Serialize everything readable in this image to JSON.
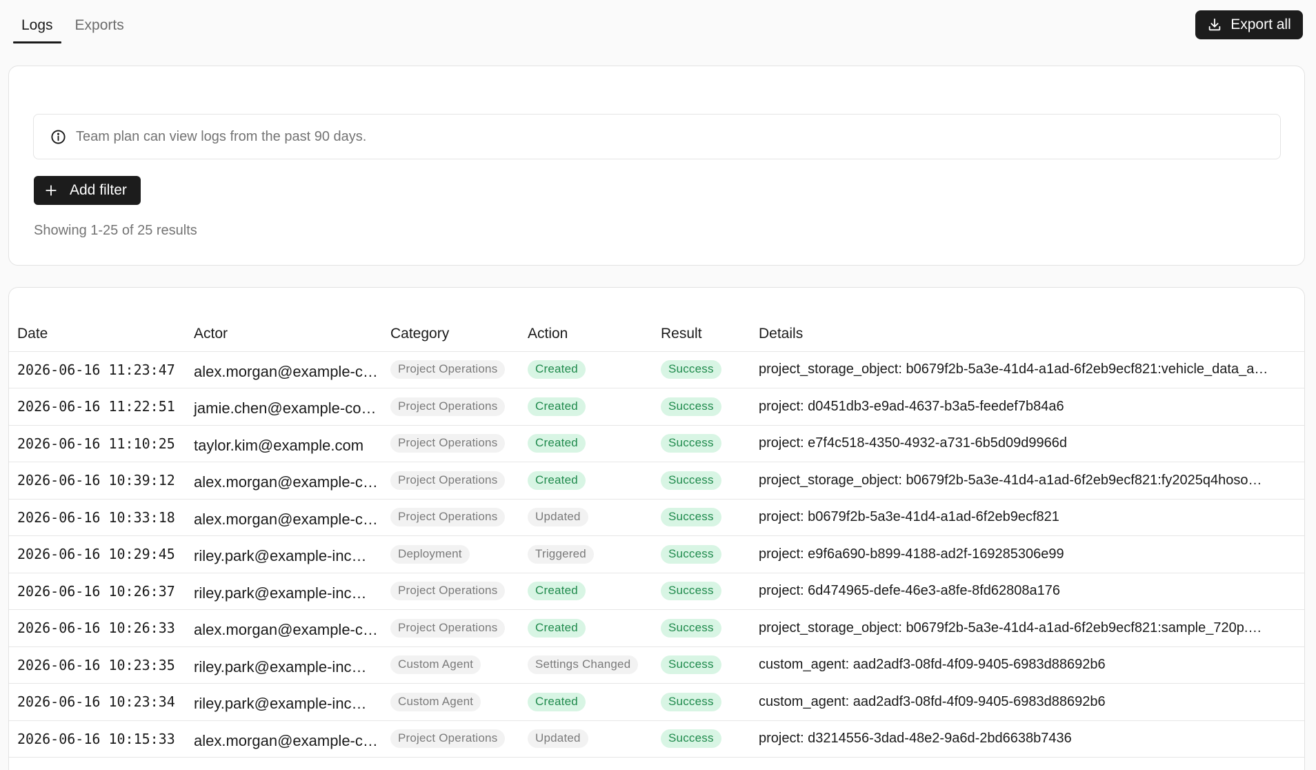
{
  "tabs": [
    {
      "label": "Logs",
      "active": true
    },
    {
      "label": "Exports",
      "active": false
    }
  ],
  "export_all_label": "Export all",
  "notice_text": "Team plan can view logs from the past 90 days.",
  "add_filter_label": "Add filter",
  "results_text": "Showing 1-25 of 25 results",
  "columns": {
    "date": "Date",
    "actor": "Actor",
    "category": "Category",
    "action": "Action",
    "result": "Result",
    "details": "Details"
  },
  "rows": [
    {
      "date": "2026-06-16 11:23:47",
      "actor": "alex.morgan@example-co…",
      "category": "Project Operations",
      "action": "Created",
      "action_style": "green",
      "result": "Success",
      "details": "project_storage_object: b0679f2b-5a3e-41d4-a1ad-6f2eb9ecf821:vehicle_data_a…"
    },
    {
      "date": "2026-06-16 11:22:51",
      "actor": "jamie.chen@example-co…",
      "category": "Project Operations",
      "action": "Created",
      "action_style": "green",
      "result": "Success",
      "details": "project: d0451db3-e9ad-4637-b3a5-feedef7b84a6"
    },
    {
      "date": "2026-06-16 11:10:25",
      "actor": "taylor.kim@example.com",
      "category": "Project Operations",
      "action": "Created",
      "action_style": "green",
      "result": "Success",
      "details": "project: e7f4c518-4350-4932-a731-6b5d09d9966d"
    },
    {
      "date": "2026-06-16 10:39:12",
      "actor": "alex.morgan@example-co…",
      "category": "Project Operations",
      "action": "Created",
      "action_style": "green",
      "result": "Success",
      "details": "project_storage_object: b0679f2b-5a3e-41d4-a1ad-6f2eb9ecf821:fy2025q4hoso…"
    },
    {
      "date": "2026-06-16 10:33:18",
      "actor": "alex.morgan@example-co…",
      "category": "Project Operations",
      "action": "Updated",
      "action_style": "grey",
      "result": "Success",
      "details": "project: b0679f2b-5a3e-41d4-a1ad-6f2eb9ecf821"
    },
    {
      "date": "2026-06-16 10:29:45",
      "actor": "riley.park@example-inc…",
      "category": "Deployment",
      "action": "Triggered",
      "action_style": "grey",
      "result": "Success",
      "details": "project: e9f6a690-b899-4188-ad2f-169285306e99"
    },
    {
      "date": "2026-06-16 10:26:37",
      "actor": "riley.park@example-inc…",
      "category": "Project Operations",
      "action": "Created",
      "action_style": "green",
      "result": "Success",
      "details": "project: 6d474965-defe-46e3-a8fe-8fd62808a176"
    },
    {
      "date": "2026-06-16 10:26:33",
      "actor": "alex.morgan@example-co…",
      "category": "Project Operations",
      "action": "Created",
      "action_style": "green",
      "result": "Success",
      "details": "project_storage_object: b0679f2b-5a3e-41d4-a1ad-6f2eb9ecf821:sample_720p.…"
    },
    {
      "date": "2026-06-16 10:23:35",
      "actor": "riley.park@example-inc…",
      "category": "Custom Agent",
      "action": "Settings Changed",
      "action_style": "grey",
      "result": "Success",
      "details": "custom_agent: aad2adf3-08fd-4f09-9405-6983d88692b6"
    },
    {
      "date": "2026-06-16 10:23:34",
      "actor": "riley.park@example-inc…",
      "category": "Custom Agent",
      "action": "Created",
      "action_style": "green",
      "result": "Success",
      "details": "custom_agent: aad2adf3-08fd-4f09-9405-6983d88692b6"
    },
    {
      "date": "2026-06-16 10:15:33",
      "actor": "alex.morgan@example-co…",
      "category": "Project Operations",
      "action": "Updated",
      "action_style": "grey",
      "result": "Success",
      "details": "project: d3214556-3dad-48e2-9a6d-2bd6638b7436"
    }
  ],
  "colors": {
    "pill_green_bg": "#d8f5e4",
    "pill_green_text": "#1f8a4c",
    "pill_grey_bg": "#f2f2f2",
    "pill_grey_text": "#7a7a7a",
    "button_dark": "#1c1c1c"
  },
  "icons": {
    "export": "download-icon",
    "notice": "info-circle-icon",
    "add_filter": "plus-icon"
  }
}
